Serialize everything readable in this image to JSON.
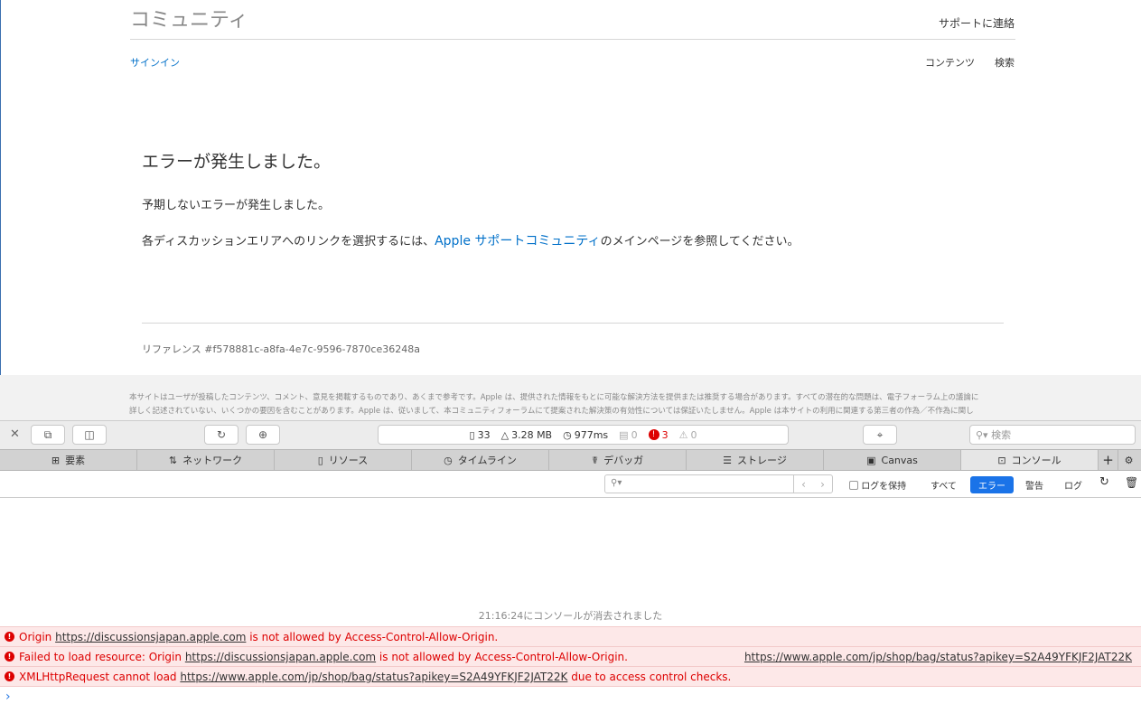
{
  "page": {
    "title": "コミュニティ",
    "contact": "サポートに連絡",
    "signin": "サインイン",
    "nav": [
      "コンテンツ",
      "検索"
    ],
    "heading": "エラーが発生しました。",
    "message": "予期しないエラーが発生しました。",
    "instr_before": "各ディスカッションエリアへのリンクを選択するには、",
    "instr_link": "Apple サポートコミュニティ",
    "instr_after": "のメインページを参照してください。",
    "reference": "リファレンス #f578881c-a8fa-4e7c-9596-7870ce36248a"
  },
  "footer": {
    "line1": "本サイトはユーザが投稿したコンテンツ、コメント、意見を掲載するものであり、あくまで参考です。Apple は、提供された情報をもとに可能な解決方法を提供または推奨する場合があります。すべての潜在的な問題は、電子フォーラム上の議論に",
    "line2": "詳しく記述されていない、いくつかの要因を含むことがあります。Apple は、従いまして、本コミュニティフォーラムにて提案された解決策の有効性については保証いたしません。Apple は本サイトの利用に関連する第三者の作為／不作為に関し"
  },
  "devtools": {
    "stats": {
      "resources": "33",
      "size": "3.28 MB",
      "time": "977ms",
      "logs": "0",
      "errors": "3",
      "warnings": "0"
    },
    "search_placeholder": "検索",
    "tabs": [
      "要素",
      "ネットワーク",
      "リソース",
      "タイムライン",
      "デバッガ",
      "ストレージ",
      "Canvas",
      "コンソール"
    ],
    "filter": {
      "preserve_log": "ログを保持",
      "all": "すべて",
      "errors": "エラー",
      "warnings": "警告",
      "logs": "ログ"
    },
    "console": {
      "cleared": "21:16:24にコンソールが消去されました",
      "errors": [
        {
          "before": "Origin ",
          "link": "https://discussionsjapan.apple.com",
          "after": " is not allowed by Access-Control-Allow-Origin.",
          "source": ""
        },
        {
          "before": "Failed to load resource: Origin ",
          "link": "https://discussionsjapan.apple.com",
          "after": " is not allowed by Access-Control-Allow-Origin.",
          "source": "https://www.apple.com/jp/shop/bag/status?apikey=S2A49YFKJF2JAT22K"
        },
        {
          "before": "XMLHttpRequest cannot load ",
          "link": "https://www.apple.com/jp/shop/bag/status?apikey=S2A49YFKJF2JAT22K",
          "after": " due to access control checks.",
          "source": ""
        }
      ],
      "prompt": "›"
    }
  },
  "colors": {
    "accent": "#0070c9",
    "error": "#dd0000",
    "active_filter": "#1a73e8"
  }
}
